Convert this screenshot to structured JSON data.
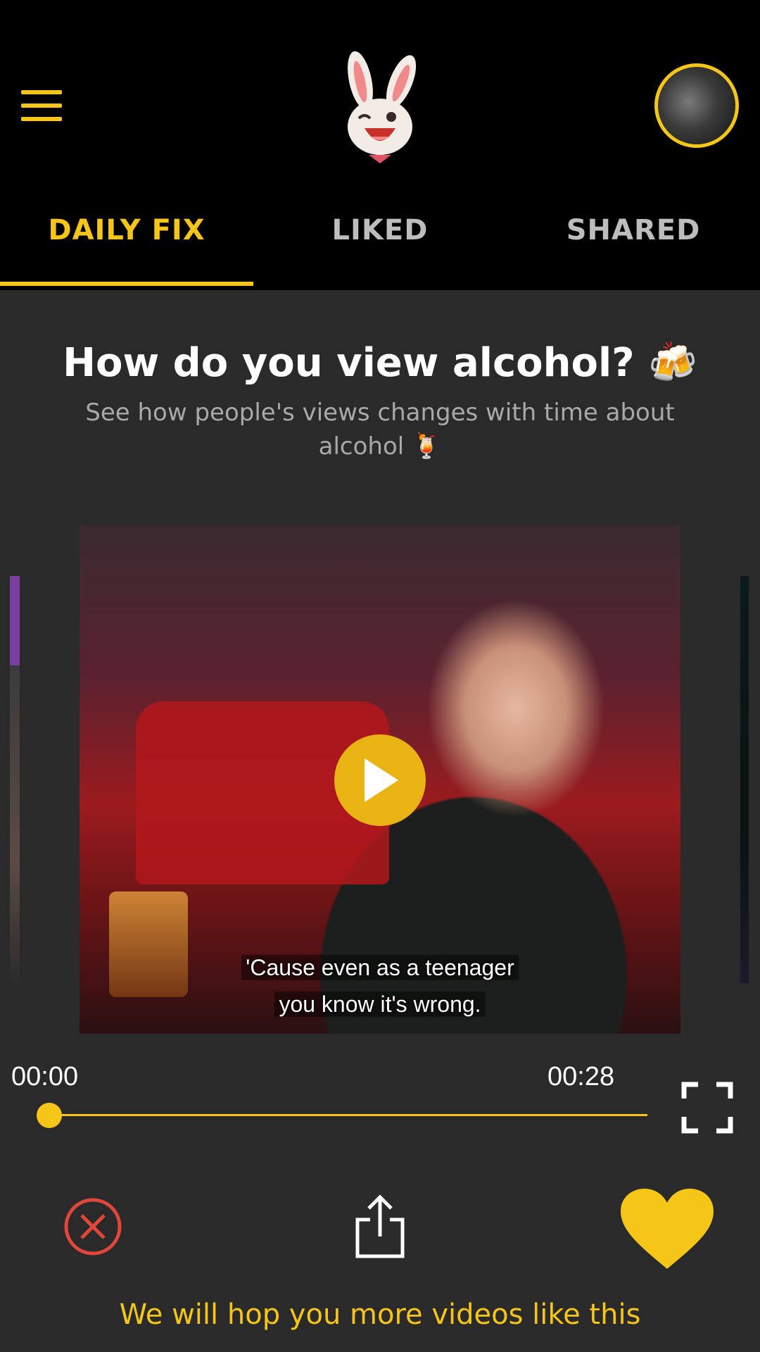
{
  "header": {
    "menu_icon": "hamburger-menu-icon",
    "logo_icon": "winking-bunny-logo",
    "avatar_icon": "user-avatar-photo"
  },
  "tabs": [
    {
      "label": "DAILY FIX",
      "active": true
    },
    {
      "label": "LIKED",
      "active": false
    },
    {
      "label": "SHARED",
      "active": false
    }
  ],
  "card": {
    "title": "How do you view alcohol? 🍻",
    "subtitle": "See how people's views changes with time about alcohol 🍹"
  },
  "video": {
    "caption_line1": "'Cause even as a teenager",
    "caption_line2": "you know it's wrong.",
    "current_time": "00:00",
    "total_time": "00:28",
    "progress": 0
  },
  "actions": {
    "dismiss_icon": "close-circle-icon",
    "share_icon": "share-icon",
    "like_icon": "heart-icon"
  },
  "footer": {
    "message": "We will hop you more videos like this"
  },
  "colors": {
    "accent": "#f5c518",
    "background": "#2a2a2a",
    "topbar": "#000000",
    "dismiss": "#e0473a"
  }
}
